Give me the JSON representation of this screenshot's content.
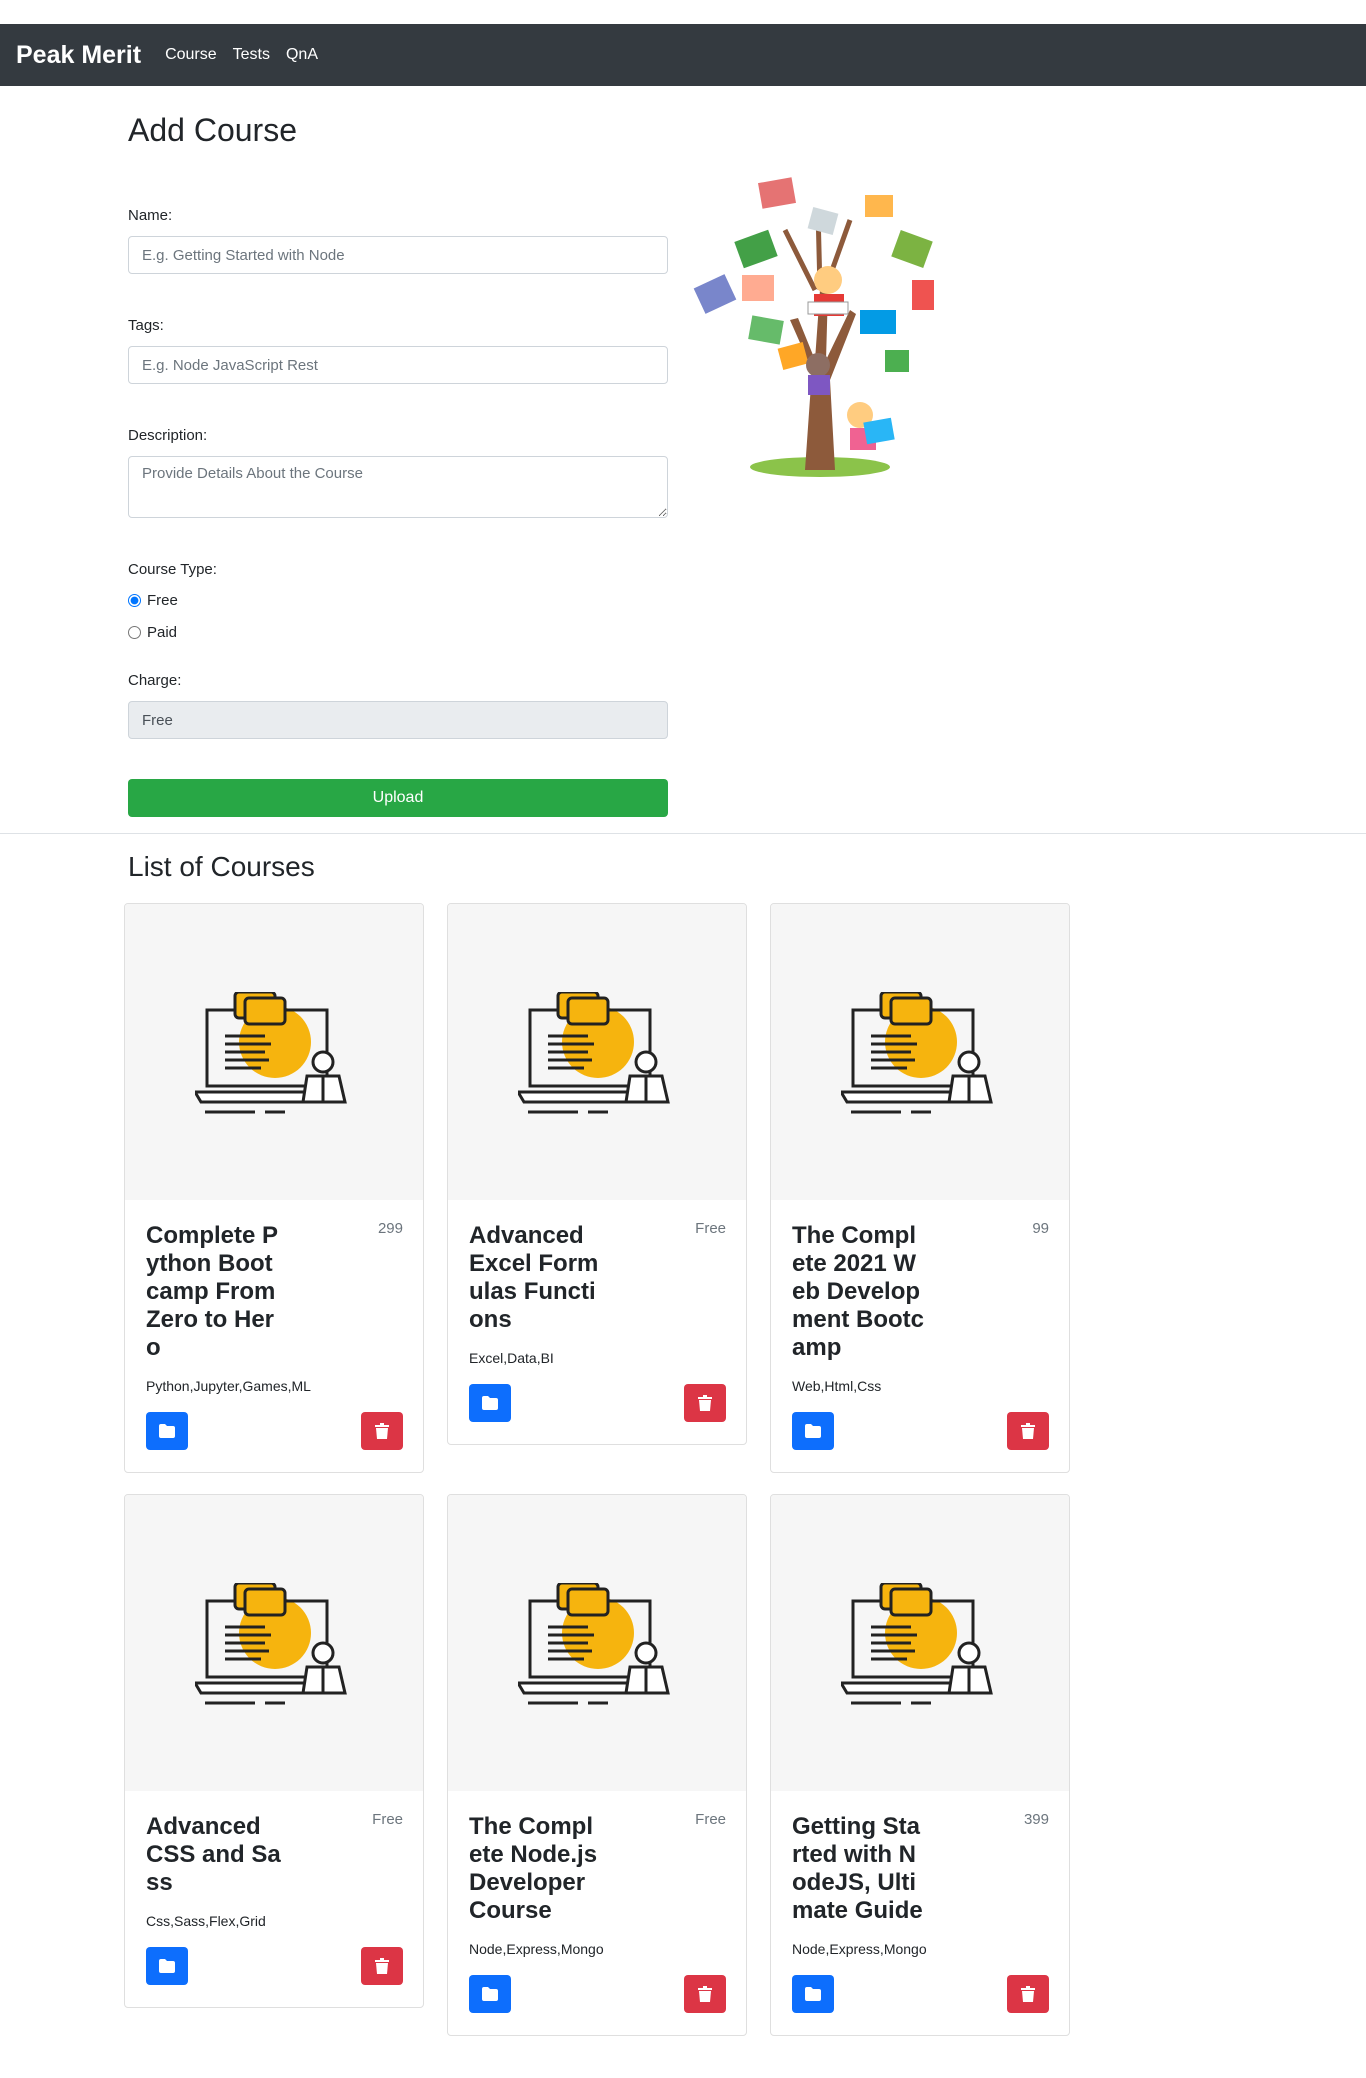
{
  "navbar": {
    "brand": "Peak Merit",
    "links": [
      "Course",
      "Tests",
      "QnA"
    ]
  },
  "form": {
    "title": "Add Course",
    "name_label": "Name:",
    "name_placeholder": "E.g. Getting Started with Node",
    "tags_label": "Tags:",
    "tags_placeholder": "E.g. Node JavaScript Rest",
    "description_label": "Description:",
    "description_placeholder": "Provide Details About the Course",
    "course_type_label": "Course Type:",
    "course_type_options": [
      "Free",
      "Paid"
    ],
    "course_type_selected": "Free",
    "charge_label": "Charge:",
    "charge_value": "Free",
    "upload_label": "Upload"
  },
  "list": {
    "title": "List of Courses",
    "courses": [
      {
        "title": "Complete Python Bootcamp From Zero to Hero",
        "charge": "299",
        "tags": "Python,Jupyter,Games,ML"
      },
      {
        "title": "Advanced Excel Formulas Functions",
        "charge": "Free",
        "tags": "Excel,Data,BI"
      },
      {
        "title": "The Complete 2021 Web Development Bootcamp",
        "charge": "99",
        "tags": "Web,Html,Css"
      },
      {
        "title": "Advanced CSS and Sass",
        "charge": "Free",
        "tags": "Css,Sass,Flex,Grid"
      },
      {
        "title": "The Complete Node.js Developer Course",
        "charge": "Free",
        "tags": "Node,Express,Mongo"
      },
      {
        "title": "Getting Started with NodeJS, Ultimate Guide",
        "charge": "399",
        "tags": "Node,Express,Mongo"
      }
    ]
  },
  "colors": {
    "navbar": "#343a40",
    "upload": "#28a745",
    "folder_button": "#0d6efd",
    "trash_button": "#dc3545"
  },
  "icons": {
    "course_thumbnail": "online-course-laptop-icon",
    "view": "folder-icon",
    "delete": "trash-icon",
    "hero": "reading-tree-illustration"
  }
}
